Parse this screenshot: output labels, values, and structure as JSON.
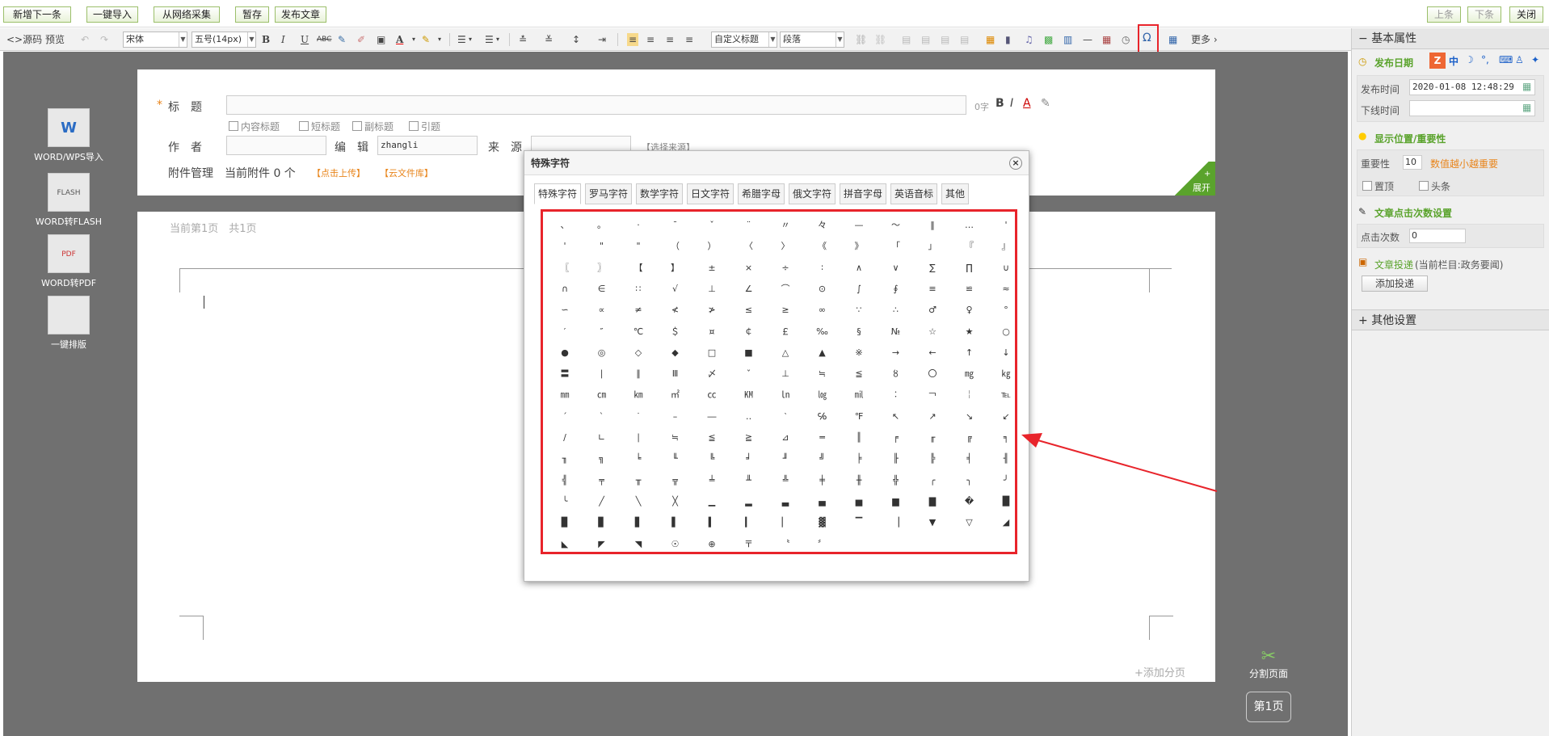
{
  "topbar": {
    "buttons": [
      "新增下一条",
      "一键导入",
      "从网络采集",
      "暂存",
      "发布文章"
    ],
    "right_buttons": [
      "上条",
      "下条",
      "关闭"
    ]
  },
  "toolbar": {
    "source": "<>源码",
    "preview": "预览",
    "font_family": "宋体",
    "font_size": "五号(14px)",
    "heading": "自定义标题",
    "paragraph": "段落",
    "more": "更多",
    "special_char_icon": "Ω"
  },
  "left_tools": [
    {
      "label": "WORD/WPS导入",
      "icon": "word-import-icon",
      "badge": "W"
    },
    {
      "label": "WORD转FLASH",
      "icon": "flash-convert-icon",
      "badge": "FLASH"
    },
    {
      "label": "WORD转PDF",
      "icon": "pdf-convert-icon",
      "badge": "PDF"
    },
    {
      "label": "一键排版",
      "icon": "auto-format-icon",
      "badge": ""
    }
  ],
  "form": {
    "title_label": "标　题",
    "required_mark": "*",
    "char_count": "0字",
    "title_options": [
      "内容标题",
      "短标题",
      "副标题",
      "引题"
    ],
    "author_label": "作　者",
    "editor_label": "编　辑",
    "editor_value": "zhangli",
    "source_label": "来　源",
    "source_select": "【选择来源】",
    "attach_label": "附件管理",
    "attach_count": "当前附件 0 个",
    "upload": "【点击上传】",
    "cloud": "【云文件库】",
    "expand": "展开",
    "expand_plus": "+"
  },
  "editor": {
    "page_info": "当前第1页　共1页",
    "add_page": "+添加分页",
    "split_page": "分割页面",
    "page_badge": "第1页"
  },
  "sidebar": {
    "basic_title": "基本属性",
    "publish_date": "发布日期",
    "publish_time_label": "发布时间",
    "publish_time_value": "2020-01-08 12:48:29",
    "offline_label": "下线时间",
    "display_title": "显示位置/重要性",
    "importance_label": "重要性",
    "importance_value": "10",
    "importance_hint": "数值越小越重要",
    "top_label": "置顶",
    "headline_label": "头条",
    "clicks_title": "文章点击次数设置",
    "clicks_label": "点击次数",
    "clicks_value": "0",
    "post_label": "文章投递",
    "post_hint": "(当前栏目:政务要闻)",
    "add_post": "添加投递",
    "other_title": "其他设置"
  },
  "dialog": {
    "title": "特殊字符",
    "tabs": [
      "特殊字符",
      "罗马字符",
      "数学字符",
      "日文字符",
      "希腊字母",
      "俄文字符",
      "拼音字母",
      "英语音标",
      "其他"
    ],
    "chars": [
      "、",
      "。",
      "·",
      "ˉ",
      "ˇ",
      "¨",
      "〃",
      "々",
      "—",
      "～",
      "‖",
      "…",
      "'",
      "'",
      "\"",
      "\"",
      "（",
      "）",
      "〈",
      "〉",
      "《",
      "》",
      "「",
      "」",
      "『",
      "』",
      "〖",
      "〗",
      "【",
      "】",
      "±",
      "×",
      "÷",
      "∶",
      "∧",
      "∨",
      "∑",
      "∏",
      "∪",
      "∩",
      "∈",
      "∷",
      "√",
      "⊥",
      "∠",
      "⌒",
      "⊙",
      "∫",
      "∮",
      "≡",
      "≌",
      "≈",
      "∽",
      "∝",
      "≠",
      "≮",
      "≯",
      "≤",
      "≥",
      "∞",
      "∵",
      "∴",
      "♂",
      "♀",
      "°",
      "′",
      "″",
      "℃",
      "＄",
      "¤",
      "￠",
      "￡",
      "‰",
      "§",
      "№",
      "☆",
      "★",
      "○",
      "●",
      "◎",
      "◇",
      "◆",
      "□",
      "■",
      "△",
      "▲",
      "※",
      "→",
      "←",
      "↑",
      "↓",
      "〓",
      "∣",
      "∥",
      "Ⅲ",
      "〆",
      "ˇ",
      "⊥",
      "≒",
      "≦",
      "〥",
      "〇",
      "㎎",
      "㎏",
      "㎜",
      "㎝",
      "㎞",
      "㎡",
      "㏄",
      "㏎",
      "㏑",
      "㏒",
      "㏕",
      "︰",
      "￢",
      "￤",
      "℡",
      "ˊ",
      "ˋ",
      "˙",
      "–",
      "―",
      "‥",
      "‵",
      "℅",
      "℉",
      "↖",
      "↗",
      "↘",
      "↙",
      "∕",
      "∟",
      "∣",
      "≒",
      "≦",
      "≧",
      "⊿",
      "═",
      "║",
      "╒",
      "╓",
      "╔",
      "╕",
      "╖",
      "╗",
      "╘",
      "╙",
      "╚",
      "╛",
      "╜",
      "╝",
      "╞",
      "╟",
      "╠",
      "╡",
      "╢",
      "╣",
      "╤",
      "╥",
      "╦",
      "╧",
      "╨",
      "╩",
      "╪",
      "╫",
      "╬",
      "╭",
      "╮",
      "╯",
      "╰",
      "╱",
      "╲",
      "╳",
      "▁",
      "▂",
      "▃",
      "▄",
      "▅",
      "▆",
      "▇",
      "�",
      "█",
      "▉",
      "▊",
      "▋",
      "▌",
      "▍",
      "▎",
      "▏",
      "▓",
      "▔",
      "▕",
      "▼",
      "▽",
      "◢",
      "◣",
      "◤",
      "◥",
      "☉",
      "⊕",
      "〒",
      "〝",
      "〞"
    ]
  }
}
